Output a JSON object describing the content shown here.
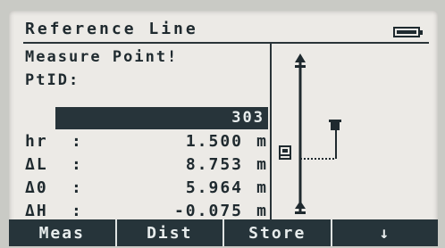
{
  "header": {
    "title": "Reference Line"
  },
  "form": {
    "line1": "Measure Point!",
    "ptid_label": "PtID:",
    "ptid_value": "303",
    "rows": [
      {
        "label": "hr",
        "colon": ":",
        "value": "1.500",
        "unit": "m"
      },
      {
        "label": "ΔL",
        "colon": ":",
        "value": "8.753",
        "unit": "m"
      },
      {
        "label": "Δ0",
        "colon": ":",
        "value": "5.964",
        "unit": "m"
      },
      {
        "label": "ΔH",
        "colon": ":",
        "value": "-0.075",
        "unit": "m"
      }
    ]
  },
  "softkeys": [
    "Meas",
    "Dist",
    "Store",
    "↓"
  ]
}
